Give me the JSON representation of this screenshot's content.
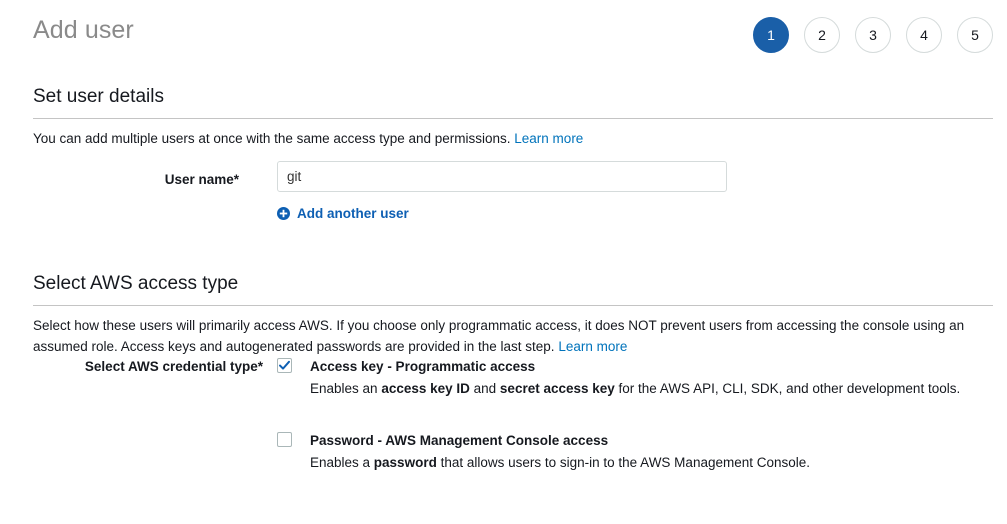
{
  "header": {
    "title": "Add user",
    "steps": [
      {
        "label": "1",
        "state": "active"
      },
      {
        "label": "2",
        "state": "inactive"
      },
      {
        "label": "3",
        "state": "inactive"
      },
      {
        "label": "4",
        "state": "inactive"
      },
      {
        "label": "5",
        "state": "inactive"
      }
    ]
  },
  "user_details": {
    "heading": "Set user details",
    "description": "You can add multiple users at once with the same access type and permissions.",
    "learn_more": "Learn more",
    "username_label": "User name*",
    "username_value": "git",
    "username_placeholder": "",
    "add_another_label": "Add another user",
    "add_another_icon": "plus-circle-icon"
  },
  "access_type": {
    "heading": "Select AWS access type",
    "description": "Select how these users will primarily access AWS. If you choose only programmatic access, it does NOT prevent users from accessing the console using an assumed role. Access keys and autogenerated passwords are provided in the last step.",
    "learn_more": "Learn more",
    "credential_label": "Select AWS credential type*",
    "options": [
      {
        "title": "Access key - Programmatic access",
        "desc_part1": "Enables an ",
        "desc_bold1": "access key ID",
        "desc_part2": " and ",
        "desc_bold2": "secret access key",
        "desc_part3": " for the AWS API, CLI, SDK, and other development tools.",
        "checked": true
      },
      {
        "title": "Password - AWS Management Console access",
        "desc_part1": "Enables a ",
        "desc_bold1": "password",
        "desc_part2": " that allows users to sign-in to the AWS Management Console.",
        "desc_bold2": "",
        "desc_part3": "",
        "checked": false
      }
    ]
  },
  "colors": {
    "accent_blue": "#1a5fa8",
    "link_blue": "#0073bb",
    "action_blue": "#0d5fb3",
    "text": "#16191f",
    "title_gray": "#8a8a8a",
    "border_gray": "#d5dbdb",
    "rule_gray": "#c4c4c4"
  }
}
